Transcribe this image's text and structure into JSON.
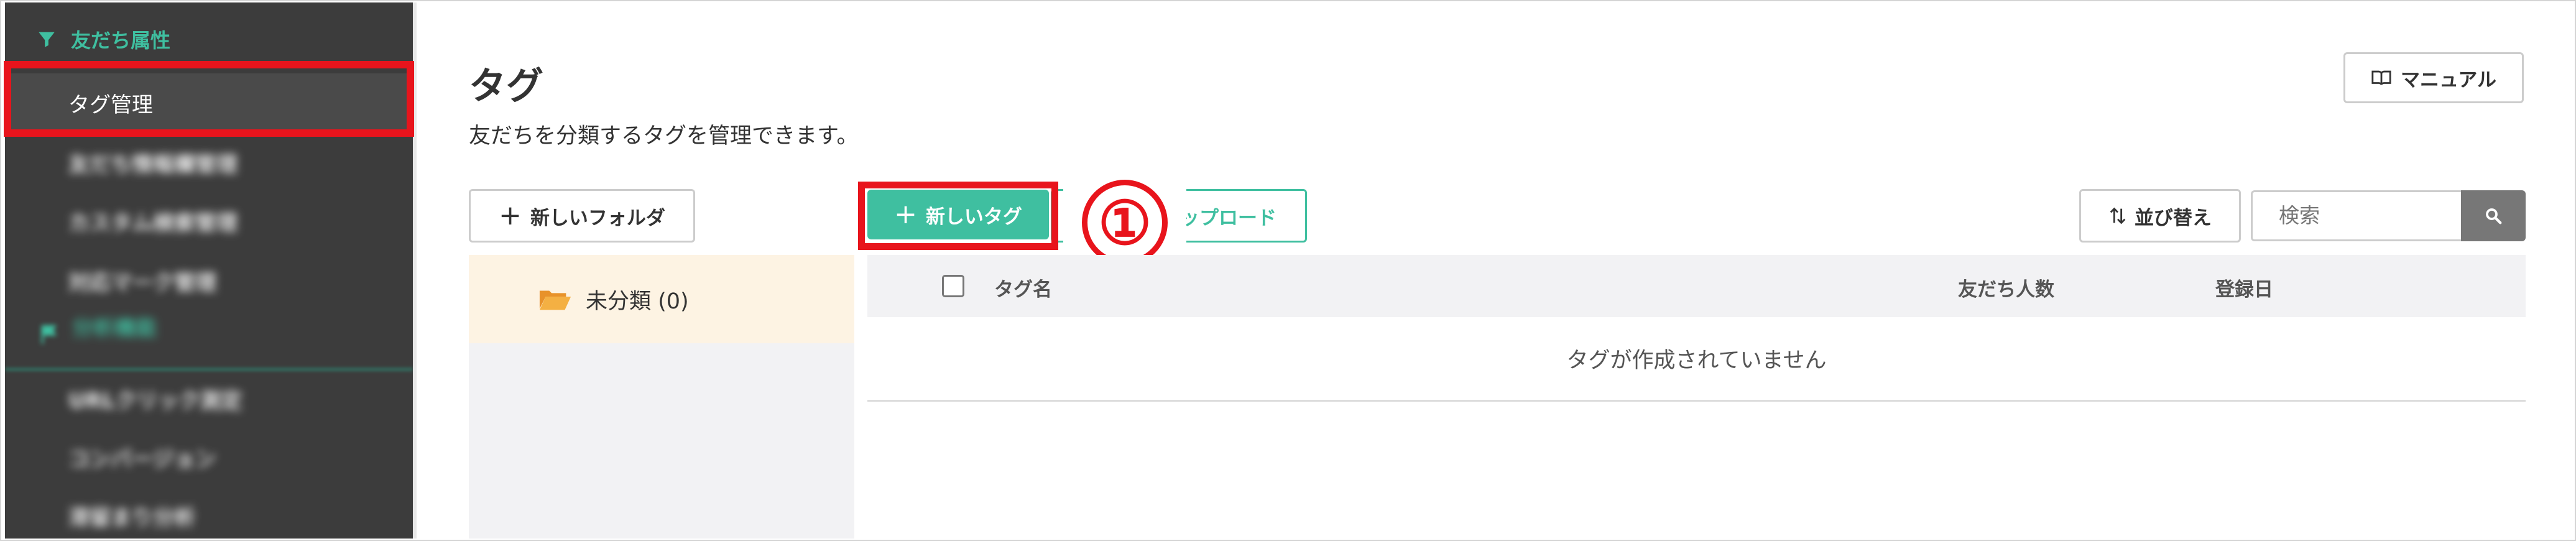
{
  "sidebar": {
    "section_title": "友だち属性",
    "items": [
      {
        "label": "タグ管理",
        "active": true
      },
      {
        "label": "友だち情報欄管理"
      },
      {
        "label": "カスタム検索管理"
      },
      {
        "label": "対応マーク管理"
      }
    ],
    "section2_title": "分析機能",
    "items2": [
      {
        "label": "URLクリック測定"
      },
      {
        "label": "コンバージョン"
      },
      {
        "label": "滞留まり分析"
      }
    ]
  },
  "header": {
    "title": "タグ",
    "description": "友だちを分類するタグを管理できます。",
    "manual_label": "マニュアル"
  },
  "toolbar": {
    "new_folder_label": "新しいフォルダ",
    "new_tag_label": "新しいタグ",
    "csv_upload_label": "ップロード",
    "sort_label": "並び替え",
    "search_placeholder": "検索"
  },
  "annotation": {
    "step": "①"
  },
  "folders": [
    {
      "label": "未分類 (0)"
    }
  ],
  "table": {
    "columns": [
      "タグ名",
      "友だち人数",
      "登録日"
    ],
    "empty_message": "タグが作成されていません"
  },
  "colors": {
    "accent": "#3fbfa0",
    "highlight": "#e8141c",
    "sidebar_bg": "#3c3c3c",
    "folder_icon": "#f0a030"
  }
}
